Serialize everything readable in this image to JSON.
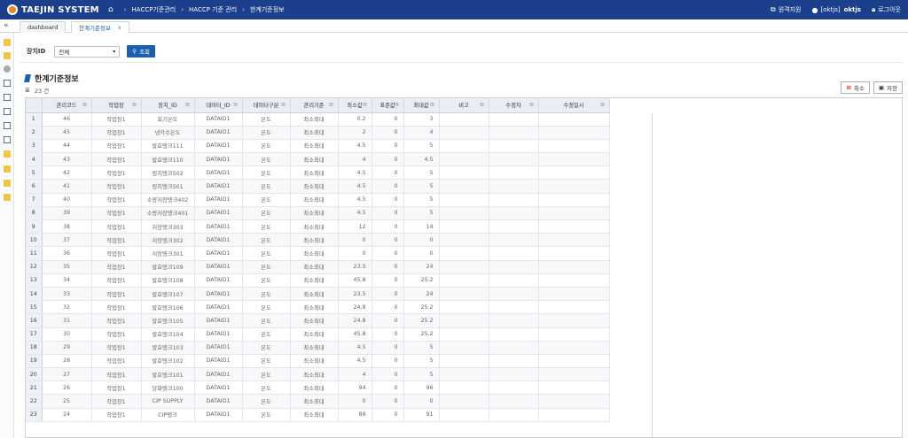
{
  "app": {
    "logo_text": "TAEJIN SYSTEM",
    "breadcrumb": [
      "HACCP기준관리",
      "HACCP 기준 관리",
      "한계기준정보"
    ],
    "remote_support": "원격지원",
    "user_id": "[oktjs]",
    "user_name": "oktjs",
    "logout": "로그아웃"
  },
  "tabs": [
    {
      "label": "dashboard"
    },
    {
      "label": "한계기준정보",
      "close": "x"
    }
  ],
  "search": {
    "device_label": "장치ID",
    "device_value": "전체",
    "search_button": "조회"
  },
  "section": {
    "title": "한계기준정보",
    "count": "23 건",
    "cancel_button": "취소",
    "save_button": "저장"
  },
  "grid": {
    "columns": [
      "관리코드",
      "작업장",
      "장치_ID",
      "데이터_ID",
      "데이터구분",
      "관리기준",
      "최소값",
      "표준값",
      "최대값",
      "비고",
      "수정자",
      "수정일시"
    ],
    "rows": [
      [
        "1",
        "46",
        "작업장1",
        "회기온도",
        "DATAID1",
        "온도",
        "최소최대",
        "0.2",
        "0",
        "3",
        "",
        "",
        ""
      ],
      [
        "2",
        "45",
        "작업장1",
        "냉각수온도",
        "DATAID1",
        "온도",
        "최소최대",
        "2",
        "0",
        "4",
        "",
        "",
        ""
      ],
      [
        "3",
        "44",
        "작업장1",
        "발효탱크111",
        "DATAID1",
        "온도",
        "최소최대",
        "4.5",
        "0",
        "5",
        "",
        "",
        ""
      ],
      [
        "4",
        "43",
        "작업장1",
        "발효탱크110",
        "DATAID1",
        "온도",
        "최소최대",
        "4",
        "0",
        "4.5",
        "",
        "",
        ""
      ],
      [
        "5",
        "42",
        "작업장1",
        "링지탱크502",
        "DATAID1",
        "온도",
        "최소최대",
        "4.5",
        "0",
        "5",
        "",
        "",
        ""
      ],
      [
        "6",
        "41",
        "작업장1",
        "링지탱크501",
        "DATAID1",
        "온도",
        "최소최대",
        "4.5",
        "0",
        "5",
        "",
        "",
        ""
      ],
      [
        "7",
        "40",
        "작업장1",
        "소량저장탱크402",
        "DATAID1",
        "온도",
        "최소최대",
        "4.5",
        "0",
        "5",
        "",
        "",
        ""
      ],
      [
        "8",
        "39",
        "작업장1",
        "소량저장탱크401",
        "DATAID1",
        "온도",
        "최소최대",
        "4.5",
        "0",
        "5",
        "",
        "",
        ""
      ],
      [
        "9",
        "38",
        "작업장1",
        "저장탱크303",
        "DATAID1",
        "온도",
        "최소최대",
        "12",
        "0",
        "14",
        "",
        "",
        ""
      ],
      [
        "10",
        "37",
        "작업장1",
        "저장탱크302",
        "DATAID1",
        "온도",
        "최소최대",
        "0",
        "0",
        "0",
        "",
        "",
        ""
      ],
      [
        "11",
        "36",
        "작업장1",
        "저장탱크301",
        "DATAID1",
        "온도",
        "최소최대",
        "0",
        "0",
        "0",
        "",
        "",
        ""
      ],
      [
        "12",
        "35",
        "작업장1",
        "발효탱크109",
        "DATAID1",
        "온도",
        "최소최대",
        "23.5",
        "0",
        "24",
        "",
        "",
        ""
      ],
      [
        "13",
        "34",
        "작업장1",
        "발효탱크108",
        "DATAID1",
        "온도",
        "최소최대",
        "45.8",
        "0",
        "25.2",
        "",
        "",
        ""
      ],
      [
        "14",
        "33",
        "작업장1",
        "발효탱크107",
        "DATAID1",
        "온도",
        "최소최대",
        "23.5",
        "0",
        "24",
        "",
        "",
        ""
      ],
      [
        "15",
        "32",
        "작업장1",
        "발효탱크106",
        "DATAID1",
        "온도",
        "최소최대",
        "24.8",
        "0",
        "25.2",
        "",
        "",
        ""
      ],
      [
        "16",
        "31",
        "작업장1",
        "발효탱크105",
        "DATAID1",
        "온도",
        "최소최대",
        "24.8",
        "0",
        "25.2",
        "",
        "",
        ""
      ],
      [
        "17",
        "30",
        "작업장1",
        "발효탱크104",
        "DATAID1",
        "온도",
        "최소최대",
        "45.8",
        "0",
        "25.2",
        "",
        "",
        ""
      ],
      [
        "18",
        "29",
        "작업장1",
        "발효탱크103",
        "DATAID1",
        "온도",
        "최소최대",
        "4.5",
        "0",
        "5",
        "",
        "",
        ""
      ],
      [
        "19",
        "28",
        "작업장1",
        "발효탱크102",
        "DATAID1",
        "온도",
        "최소최대",
        "4.5",
        "0",
        "5",
        "",
        "",
        ""
      ],
      [
        "20",
        "27",
        "작업장1",
        "발효탱크101",
        "DATAID1",
        "온도",
        "최소최대",
        "4",
        "0",
        "5",
        "",
        "",
        ""
      ],
      [
        "21",
        "26",
        "작업장1",
        "당화탱크100",
        "DATAID1",
        "온도",
        "최소최대",
        "94",
        "0",
        "96",
        "",
        "",
        ""
      ],
      [
        "22",
        "25",
        "작업장1",
        "CIP SUPPLY",
        "DATAID1",
        "온도",
        "최소최대",
        "0",
        "0",
        "0",
        "",
        "",
        ""
      ],
      [
        "23",
        "24",
        "작업장1",
        "CIP탱크",
        "DATAID1",
        "온도",
        "최소최대",
        "89",
        "0",
        "91",
        "",
        "",
        ""
      ]
    ]
  }
}
